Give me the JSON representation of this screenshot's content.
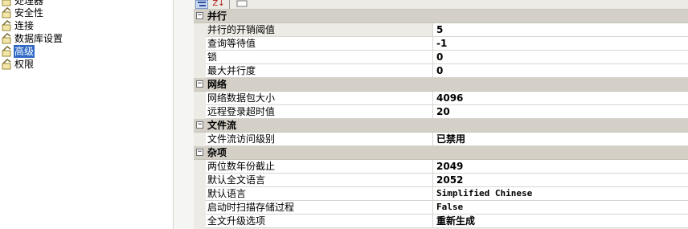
{
  "nav": {
    "items": [
      {
        "label": "处理器",
        "icon": "settings-page-icon"
      },
      {
        "label": "安全性",
        "icon": "settings-page-icon"
      },
      {
        "label": "连接",
        "icon": "settings-page-icon"
      },
      {
        "label": "数据库设置",
        "icon": "settings-page-icon"
      },
      {
        "label": "高级",
        "icon": "settings-page-icon",
        "selected": true
      },
      {
        "label": "权限",
        "icon": "settings-page-icon"
      }
    ]
  },
  "toolbar": {
    "categorized_icon": "categorized-view-icon",
    "alphabetical_label": "Z↓",
    "pages_icon": "property-pages-icon"
  },
  "grid": {
    "categories": [
      {
        "label": "并行",
        "rows": [
          {
            "name": "并行的开销阈值",
            "value": "5"
          },
          {
            "name": "查询等待值",
            "value": "-1"
          },
          {
            "name": "锁",
            "value": "0"
          },
          {
            "name": "最大并行度",
            "value": "0"
          }
        ]
      },
      {
        "label": "网络",
        "rows": [
          {
            "name": "网络数据包大小",
            "value": "4096"
          },
          {
            "name": "远程登录超时值",
            "value": "20"
          }
        ]
      },
      {
        "label": "文件流",
        "rows": [
          {
            "name": "文件流访问级别",
            "value": "已禁用"
          }
        ]
      },
      {
        "label": "杂项",
        "rows": [
          {
            "name": "两位数年份截止",
            "value": "2049"
          },
          {
            "name": "默认全文语言",
            "value": "2052"
          },
          {
            "name": "默认语言",
            "value": "Simplified Chinese"
          },
          {
            "name": "启动时扫描存储过程",
            "value": "False"
          },
          {
            "name": "全文升级选项",
            "value": "重新生成"
          }
        ]
      }
    ],
    "toggle_glyph": "−"
  },
  "colors": {
    "selection": "#316ac5",
    "category_band": "#d4d0c8",
    "grid_background": "#ecebe5"
  }
}
